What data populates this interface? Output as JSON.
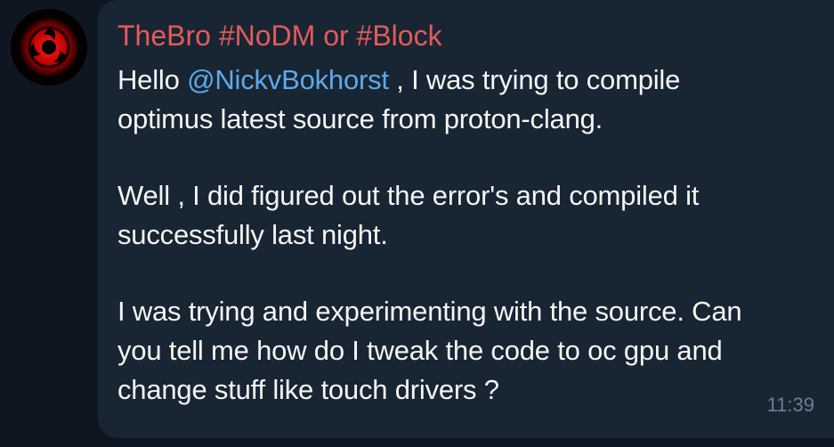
{
  "message": {
    "sender": "TheBro #NoDM or #Block",
    "paragraph1": {
      "prefix": "Hello ",
      "mention": "@NickvBokhorst",
      "suffix": " , I was trying to compile",
      "line2": "optimus latest source from proton-clang."
    },
    "paragraph2": [
      "Well , I did figured out the error's and compiled it",
      "successfully last night."
    ],
    "paragraph3": [
      "I was trying and experimenting with the source. Can",
      "you tell me how do I tweak the code to oc gpu and",
      "change stuff like touch drivers ?"
    ],
    "time": "11:39"
  },
  "colors": {
    "background": "#0e1621",
    "bubble": "#182533",
    "sender_name": "#e35b5b",
    "mention": "#5ea9ea",
    "text": "#f5f5f5",
    "timestamp": "#6d7f8f"
  },
  "avatar": {
    "icon": "sharingan-icon"
  }
}
